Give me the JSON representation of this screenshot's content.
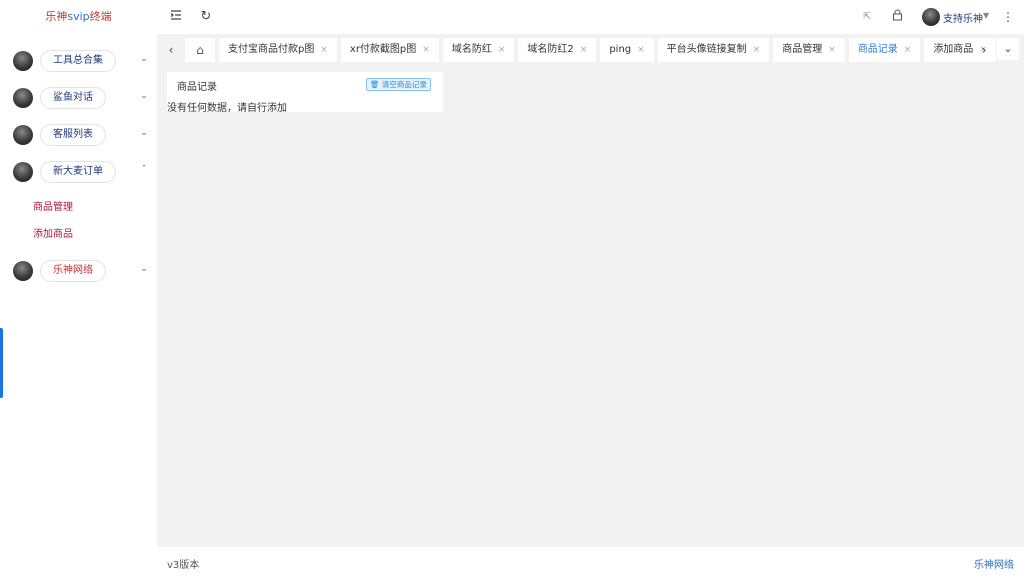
{
  "brand": {
    "part1": "乐神",
    "part2": "svip",
    "part3": "终端"
  },
  "sidebar": {
    "items": [
      {
        "label": "工具总合集",
        "expanded": false
      },
      {
        "label": "鲨鱼对话",
        "expanded": false
      },
      {
        "label": "客服列表",
        "expanded": false
      },
      {
        "label": "新大麦订单",
        "expanded": true
      },
      {
        "label": "乐神网络",
        "expanded": false
      }
    ],
    "submenu": [
      "商品管理",
      "添加商品"
    ]
  },
  "header": {
    "user_name": "支持乐神",
    "icons": [
      "menu-fold-icon",
      "refresh-icon",
      "fullscreen-icon",
      "lock-icon",
      "more-icon"
    ]
  },
  "tabs": {
    "items": [
      {
        "label": "支付宝商品付款p图"
      },
      {
        "label": "xr付款截图p图"
      },
      {
        "label": "域名防红"
      },
      {
        "label": "域名防红2"
      },
      {
        "label": "ping"
      },
      {
        "label": "平台头像链接复制"
      },
      {
        "label": "商品管理"
      },
      {
        "label": "商品记录",
        "active": true
      },
      {
        "label": "添加商品"
      }
    ],
    "close_glyph": "×"
  },
  "content": {
    "card_title": "商品记录",
    "clear_button": "清空商品记录",
    "empty_text": "没有任何数据，请自行添加"
  },
  "footer": {
    "version": "v3版本",
    "right_text": "乐神网络"
  },
  "colors": {
    "accent": "#2d7bd8",
    "brand_red": "#c0392b",
    "submenu_red": "#b0163f"
  }
}
